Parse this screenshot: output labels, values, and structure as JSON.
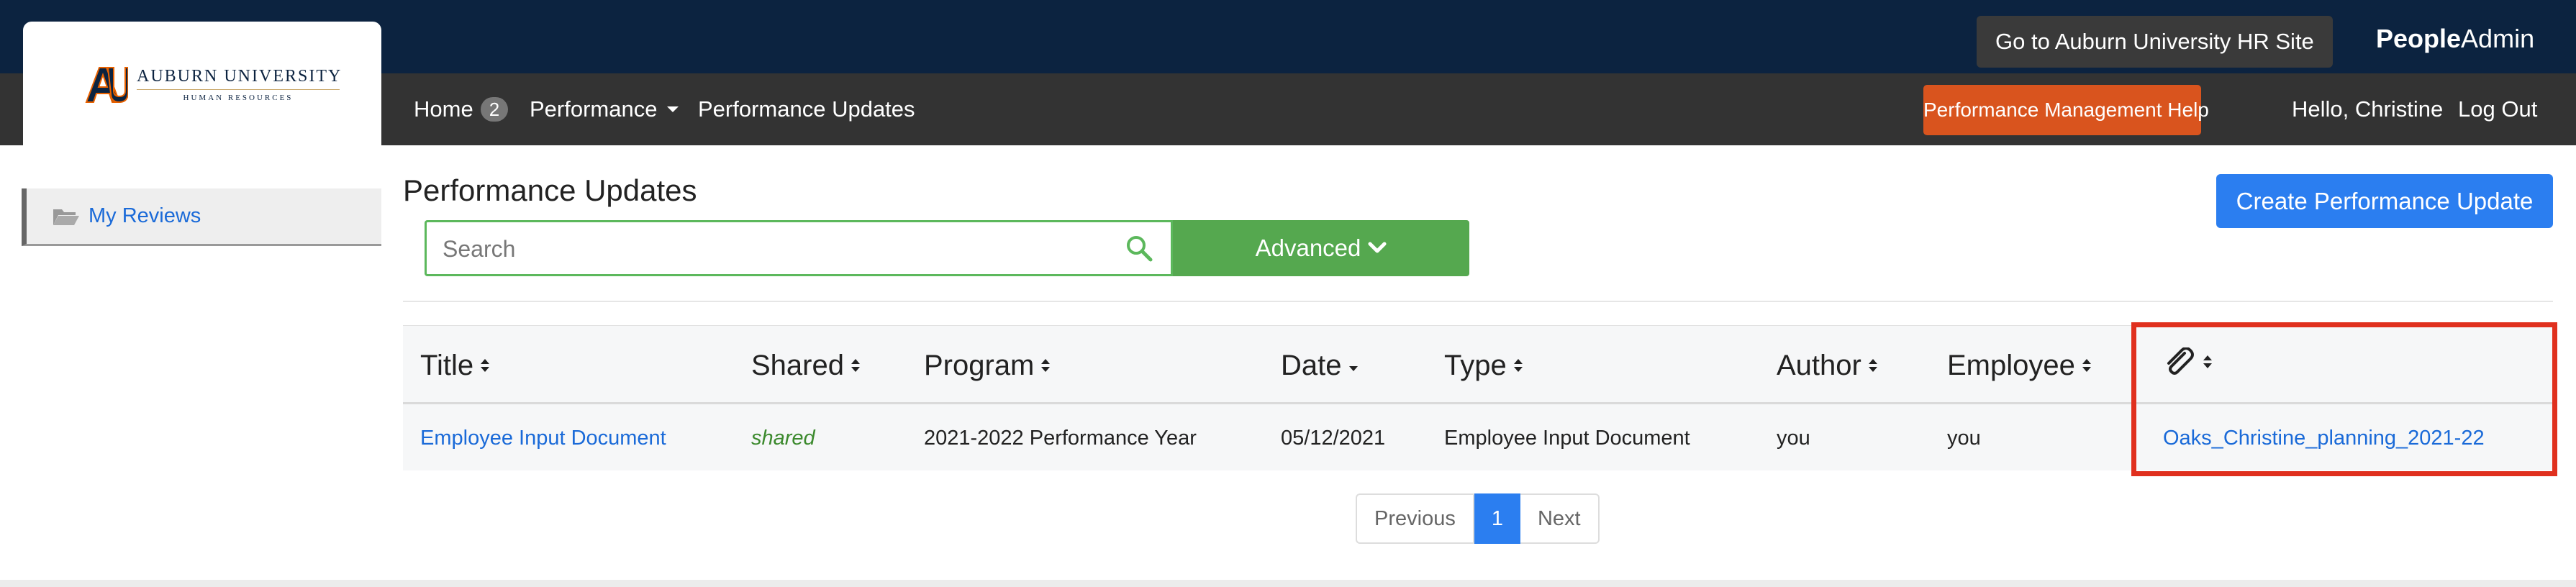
{
  "topbar": {
    "hr_site_button": "Go to Auburn University HR Site",
    "brand_bold": "People",
    "brand_regular": "Admin"
  },
  "logo": {
    "title": "AUBURN UNIVERSITY",
    "subtitle": "HUMAN RESOURCES",
    "colors": {
      "navy": "#0c2340",
      "orange": "#e86100"
    }
  },
  "nav": {
    "home_label": "Home",
    "home_badge": "2",
    "performance_label": "Performance",
    "updates_label": "Performance Updates",
    "help_button": "Performance Management Help",
    "greeting": "Hello, Christine",
    "logout": "Log Out"
  },
  "sidebar": {
    "items": [
      {
        "label": "My Reviews",
        "icon": "folder-open-icon"
      }
    ]
  },
  "main": {
    "title": "Performance Updates",
    "create_button": "Create Performance Update",
    "search": {
      "placeholder": "Search",
      "value": ""
    },
    "advanced_button": "Advanced"
  },
  "table": {
    "columns": [
      "Title",
      "Shared",
      "Program",
      "Date",
      "Type",
      "Author",
      "Employee",
      "attachment-icon"
    ],
    "rows": [
      {
        "title": "Employee Input Document",
        "shared": "shared",
        "program": "2021-2022 Performance Year",
        "date": "05/12/2021",
        "type": "Employee Input Document",
        "author": "you",
        "employee": "you",
        "attachment": "Oaks_Christine_planning_2021-22"
      }
    ]
  },
  "pagination": {
    "previous": "Previous",
    "current": "1",
    "next": "Next"
  },
  "colors": {
    "topbar": "#0c2340",
    "navbar": "#333333",
    "help_button": "#d9541e",
    "primary": "#2b7ef0",
    "advanced": "#55a84f",
    "highlight": "#e0301e"
  }
}
